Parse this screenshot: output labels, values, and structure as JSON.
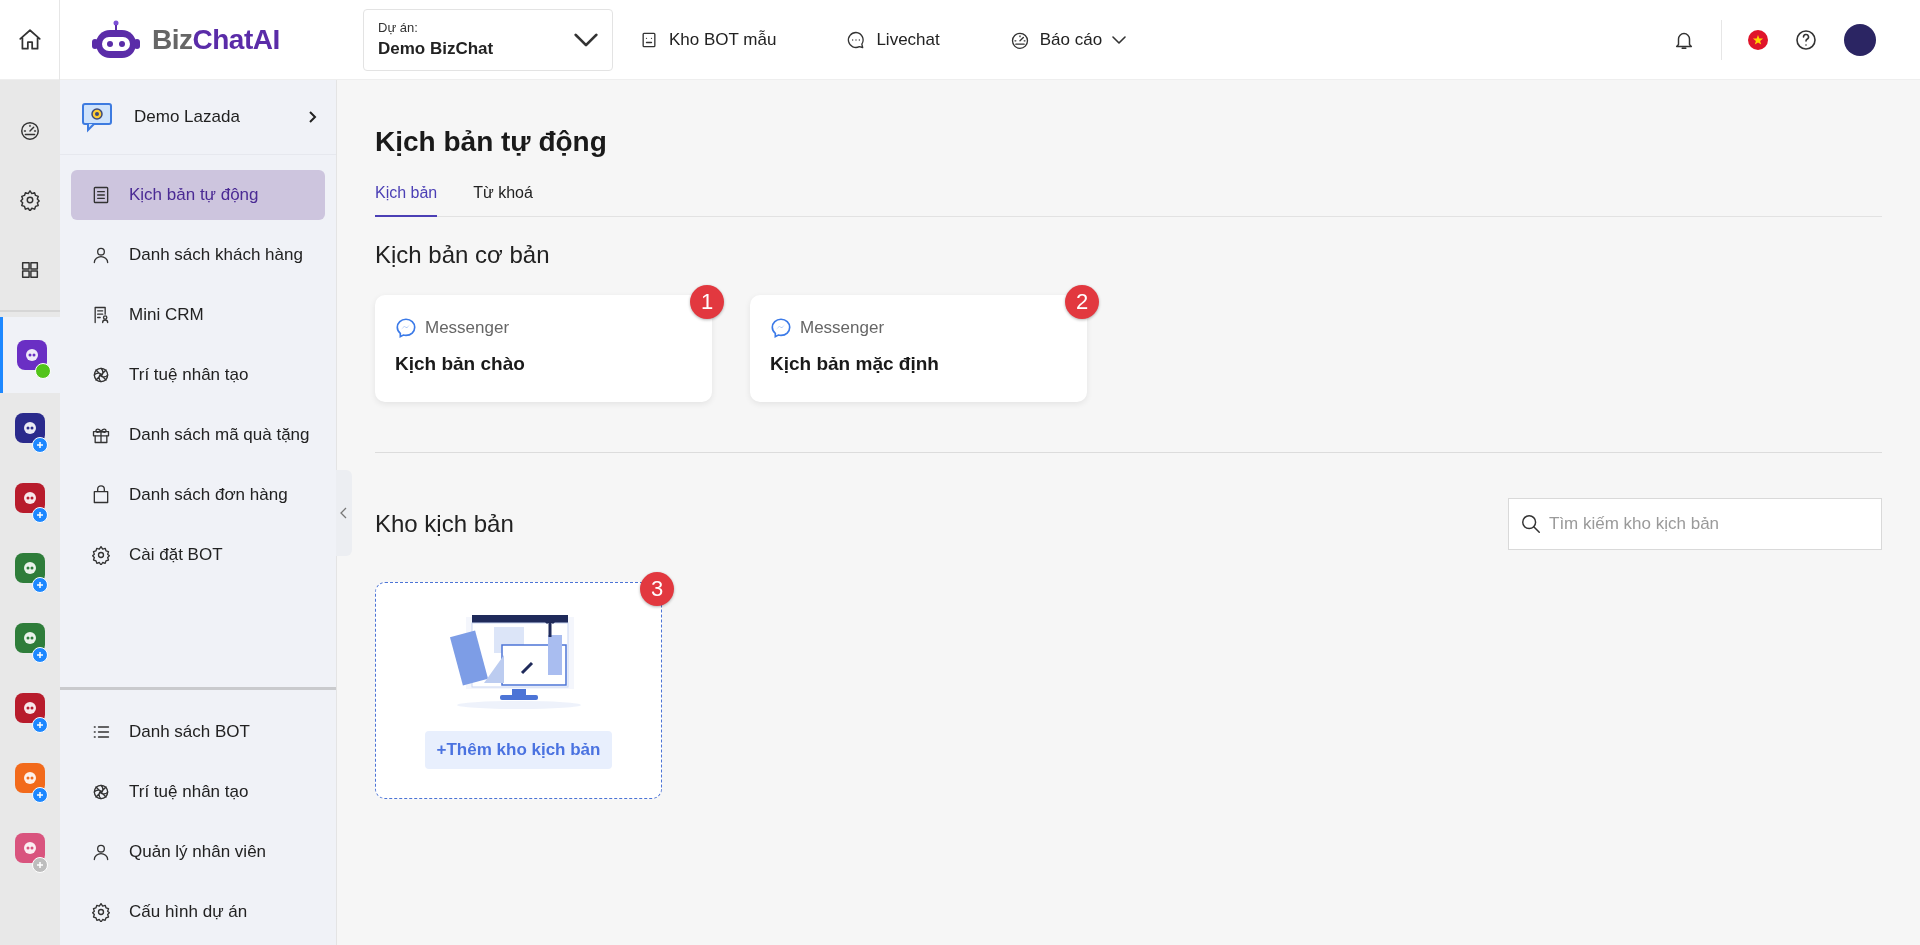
{
  "topbar": {
    "logo": {
      "part_1": "Biz",
      "part_2": "ChatAI"
    },
    "project": {
      "label": "Dự án:",
      "value": "Demo BizChat"
    },
    "nav": [
      {
        "label": "Kho BOT mẫu",
        "dropdown": false
      },
      {
        "label": "Livechat",
        "dropdown": false
      },
      {
        "label": "Báo cáo",
        "dropdown": true
      }
    ]
  },
  "rail": {
    "apps": [
      {
        "selected": true,
        "color": "#6a2fc4",
        "online": true,
        "disabled": false
      },
      {
        "selected": false,
        "color": "#2a2a8c",
        "online": false,
        "disabled": false
      },
      {
        "selected": false,
        "color": "#b81c2c",
        "online": false,
        "disabled": false
      },
      {
        "selected": false,
        "color": "#2e7d3a",
        "online": false,
        "disabled": false
      },
      {
        "selected": false,
        "color": "#2e7d3a",
        "online": false,
        "disabled": false
      },
      {
        "selected": false,
        "color": "#b81c2c",
        "online": false,
        "disabled": false
      },
      {
        "selected": false,
        "color": "#f26a1b",
        "online": false,
        "disabled": false
      },
      {
        "selected": false,
        "color": "#d9547e",
        "online": false,
        "disabled": true
      }
    ]
  },
  "sidebar": {
    "project": "Demo Lazada",
    "items": [
      {
        "label": "Kịch bản tự động",
        "selected": true
      },
      {
        "label": "Danh sách khách hàng",
        "selected": false
      },
      {
        "label": "Mini CRM",
        "selected": false
      },
      {
        "label": "Trí tuệ nhân tạo",
        "selected": false
      },
      {
        "label": "Danh sách mã quà tặng",
        "selected": false
      },
      {
        "label": "Danh sách đơn hàng",
        "selected": false
      },
      {
        "label": "Cài đặt BOT",
        "selected": false
      }
    ],
    "bottom_items": [
      {
        "label": "Danh sách BOT",
        "selected": false
      },
      {
        "label": "Trí tuệ nhân tạo",
        "selected": false
      },
      {
        "label": "Quản lý nhân viên",
        "selected": false
      },
      {
        "label": "Cấu hình dự án",
        "selected": false
      }
    ]
  },
  "main": {
    "title": "Kịch bản tự động",
    "tabs": [
      {
        "label": "Kịch bản",
        "selected": true
      },
      {
        "label": "Từ khoá",
        "selected": false
      }
    ],
    "basic": {
      "heading": "Kịch bản cơ bản",
      "cards": [
        {
          "channel": "Messenger",
          "title": "Kịch bản chào",
          "marker": "1"
        },
        {
          "channel": "Messenger",
          "title": "Kịch bản mặc định",
          "marker": "2"
        }
      ]
    },
    "library": {
      "heading": "Kho kịch bản",
      "search": {
        "placeholder": "Tìm kiếm kho kịch bản"
      },
      "add_card": {
        "button": "+Thêm kho kịch bản",
        "marker": "3"
      }
    }
  }
}
